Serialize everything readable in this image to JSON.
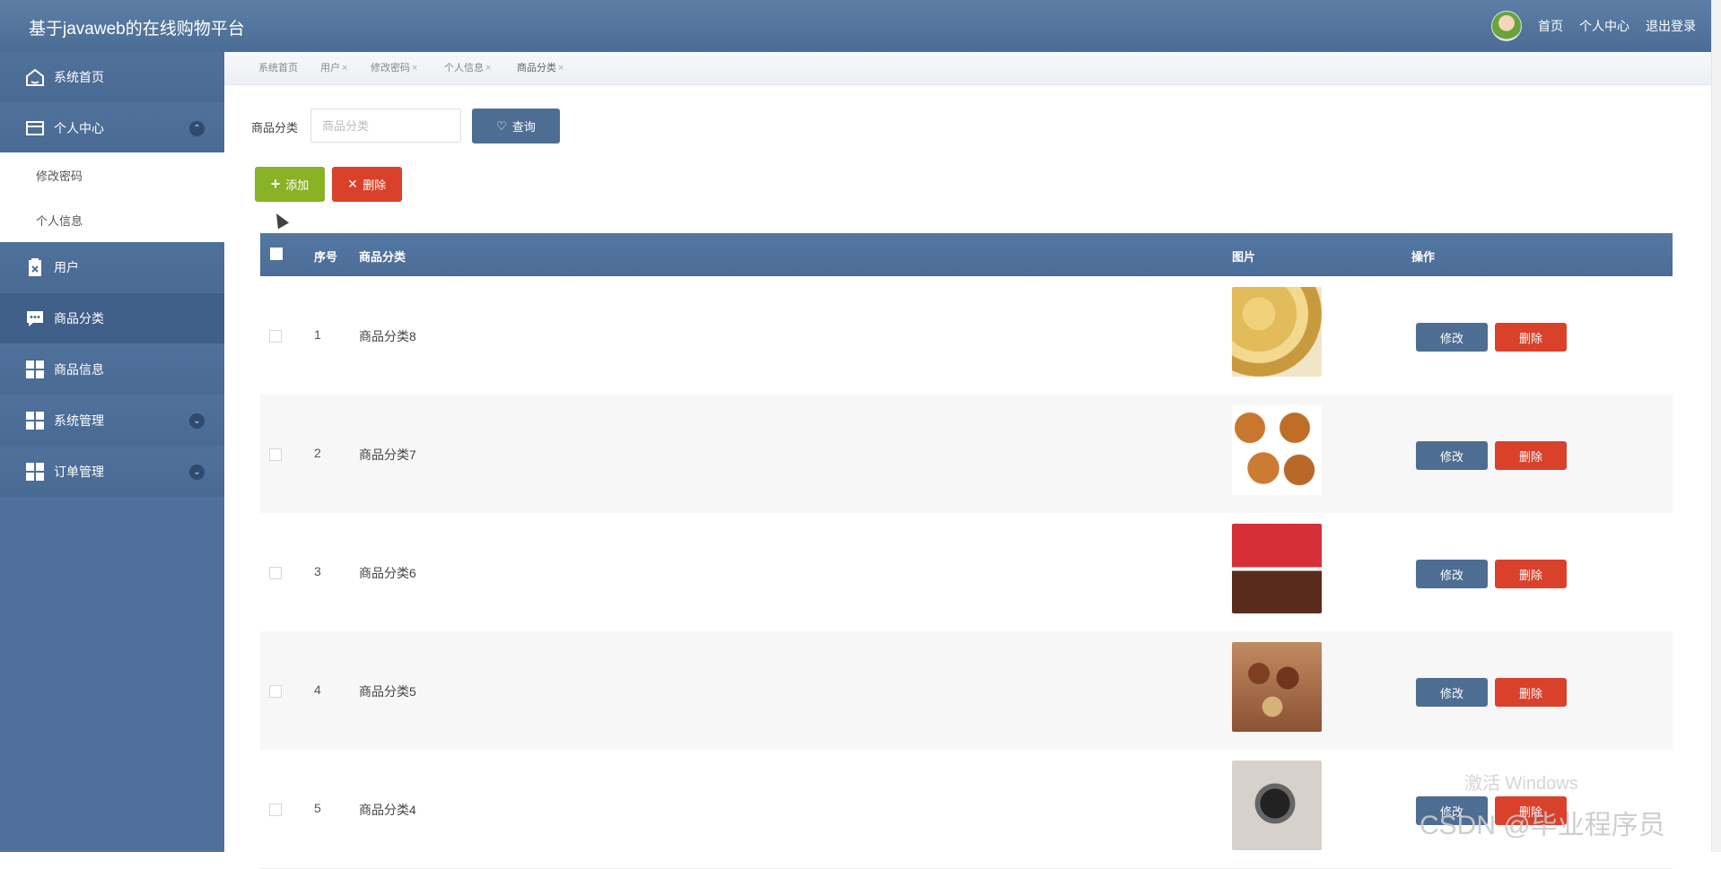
{
  "app": {
    "title": "基于javaweb的在线购物平台"
  },
  "header": {
    "links": [
      "首页",
      "个人中心",
      "退出登录"
    ]
  },
  "sidebar": {
    "items": [
      {
        "label": "系统首页",
        "icon": "home-icon"
      },
      {
        "label": "个人中心",
        "icon": "card-icon",
        "expanded": true
      },
      {
        "label": "修改密码",
        "icon": ""
      },
      {
        "label": "个人信息",
        "icon": ""
      },
      {
        "label": "用户",
        "icon": "clipboard-icon"
      },
      {
        "label": "商品分类",
        "icon": "chat-icon",
        "active": true
      },
      {
        "label": "商品信息",
        "icon": "grid-icon"
      },
      {
        "label": "系统管理",
        "icon": "grid-icon"
      },
      {
        "label": "订单管理",
        "icon": "grid-icon"
      }
    ]
  },
  "tabs": [
    {
      "label": "系统首页",
      "closable": false
    },
    {
      "label": "用户",
      "closable": true
    },
    {
      "label": "修改密码",
      "closable": true
    },
    {
      "label": "个人信息",
      "closable": true
    },
    {
      "label": "商品分类",
      "closable": true
    }
  ],
  "filters": {
    "label": "商品分类",
    "placeholder": "商品分类",
    "query_label": "查询"
  },
  "actions": {
    "add_label": "添加",
    "delete_label": "删除"
  },
  "table": {
    "headers": [
      "序号",
      "商品分类",
      "图片",
      "操作"
    ],
    "rows": [
      {
        "index": "1",
        "name": "商品分类8",
        "image": "potato-image",
        "edit": "修改",
        "delete": "删除"
      },
      {
        "index": "2",
        "name": "商品分类7",
        "image": "fried-chicken-image",
        "edit": "修改",
        "delete": "删除"
      },
      {
        "index": "3",
        "name": "商品分类6",
        "image": "chocolate-image",
        "edit": "修改",
        "delete": "删除"
      },
      {
        "index": "4",
        "name": "商品分类5",
        "image": "nuts-image",
        "edit": "修改",
        "delete": "删除"
      },
      {
        "index": "5",
        "name": "商品分类4",
        "image": "watch-image",
        "edit": "修改",
        "delete": "删除"
      }
    ]
  },
  "watermarks": {
    "activation": "激活 Windows",
    "csdn": "CSDN @毕业程序员"
  },
  "colors": {
    "topbar": "#4f709a",
    "sidebar": "#4f709a",
    "primary_button": "#4e6d92",
    "danger_button": "#d9412b",
    "success_button": "#8ab225"
  }
}
